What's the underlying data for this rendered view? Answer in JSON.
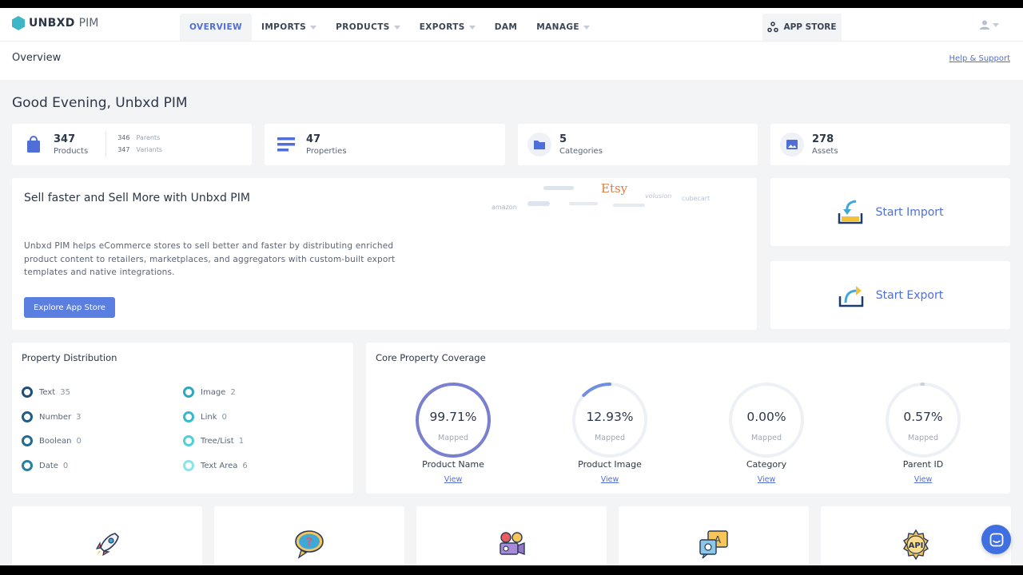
{
  "brand": {
    "name_bold": "UNBXD",
    "name_light": "PIM"
  },
  "nav": {
    "tabs": [
      {
        "label": "OVERVIEW"
      },
      {
        "label": "IMPORTS"
      },
      {
        "label": "PRODUCTS"
      },
      {
        "label": "EXPORTS"
      },
      {
        "label": "DAM"
      },
      {
        "label": "MANAGE"
      }
    ],
    "app_store": "APP STORE"
  },
  "subheader": {
    "title": "Overview",
    "help": "Help & Support"
  },
  "greeting": "Good Evening, Unbxd PIM",
  "stats": {
    "products": {
      "value": "347",
      "label": "Products",
      "parents_value": "346",
      "parents_label": "Parents",
      "variants_value": "347",
      "variants_label": "Variants"
    },
    "properties": {
      "value": "47",
      "label": "Properties"
    },
    "categories": {
      "value": "5",
      "label": "Categories"
    },
    "assets": {
      "value": "278",
      "label": "Assets"
    }
  },
  "promo": {
    "title": "Sell faster and Sell More with Unbxd PIM",
    "description": "Unbxd PIM helps eCommerce stores to sell better and faster by distributing enriched product content to retailers, marketplaces, and aggregators with custom-built export templates and native integrations.",
    "button": "Explore App Store",
    "logos": [
      "Etsy",
      "amazon",
      "cubecart",
      "volusion"
    ]
  },
  "actions": {
    "import": "Start Import",
    "export": "Start Export"
  },
  "property_distribution": {
    "title": "Property Distribution",
    "items": [
      {
        "label": "Text",
        "count": "35",
        "color": "#1d4f7c"
      },
      {
        "label": "Number",
        "count": "3",
        "color": "#1f5d86"
      },
      {
        "label": "Boolean",
        "count": "0",
        "color": "#226b92"
      },
      {
        "label": "Date",
        "count": "0",
        "color": "#27809f"
      },
      {
        "label": "Image",
        "count": "2",
        "color": "#2fa6bf"
      },
      {
        "label": "Link",
        "count": "0",
        "color": "#34bccd"
      },
      {
        "label": "Tree/List",
        "count": "1",
        "color": "#4fd0d8"
      },
      {
        "label": "Text Area",
        "count": "6",
        "color": "#8ae3e6"
      }
    ]
  },
  "core_coverage": {
    "title": "Core Property Coverage",
    "mapped_label": "Mapped",
    "view_label": "View",
    "items": [
      {
        "pct_text": "99.71%",
        "fraction": 0.9971,
        "name": "Product Name"
      },
      {
        "pct_text": "12.93%",
        "fraction": 0.1293,
        "name": "Product Image"
      },
      {
        "pct_text": "0.00%",
        "fraction": 0.0,
        "name": "Category"
      },
      {
        "pct_text": "0.57%",
        "fraction": 0.0057,
        "name": "Parent ID"
      }
    ]
  },
  "features": [
    {
      "icon": "rocket-icon"
    },
    {
      "icon": "help-bubble-icon"
    },
    {
      "icon": "video-camera-icon"
    },
    {
      "icon": "translate-icon"
    },
    {
      "icon": "api-gear-icon"
    }
  ],
  "colors": {
    "accent": "#4f6ed8",
    "button": "#5b7fe0",
    "gauge": "#7b7fd0",
    "track": "#edf0f5"
  }
}
